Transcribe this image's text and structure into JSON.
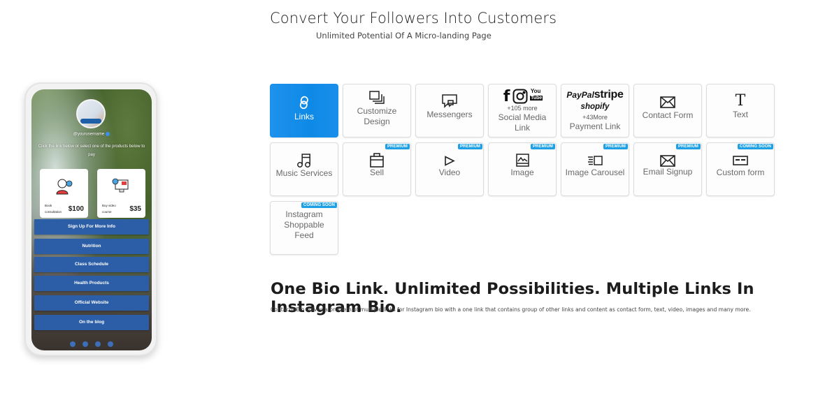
{
  "hero": {
    "title": "Convert Your Followers Into Customers",
    "subtitle": "Unlimited Potential Of A Micro-landing Page"
  },
  "phone": {
    "username": "@yourusername",
    "instructions": "Click the link below or select one of the products below to pay",
    "products": [
      {
        "name": "Book consultation",
        "price": "$100",
        "icon": "consultant-icon"
      },
      {
        "name": "Buy video course",
        "price": "$35",
        "icon": "video-course-icon"
      }
    ],
    "links": [
      "Sign Up For More Info",
      "Nutrition",
      "Class Schedule",
      "Health Products",
      "Official Website",
      "On the blog"
    ],
    "link_color": "#2c5ea8"
  },
  "features": [
    {
      "label": "Links",
      "icon": "link-icon",
      "active": true,
      "badge": null
    },
    {
      "label": "Customize Design",
      "icon": "layers-icon",
      "badge": null
    },
    {
      "label": "Messengers",
      "icon": "chat-bubbles-icon",
      "badge": null
    },
    {
      "label": "Social Media Link",
      "icon": "social-brands-icon",
      "extra": "+105 more",
      "brands": [
        "f",
        "Instagram",
        "YouTube"
      ],
      "badge": null
    },
    {
      "label": "Payment Link",
      "icon": "payment-brands-icon",
      "extra": "+43More",
      "brands": [
        "PayPal",
        "stripe",
        "shopify"
      ],
      "badge": null
    },
    {
      "label": "Contact Form",
      "icon": "envelope-icon",
      "badge": null
    },
    {
      "label": "Text",
      "icon": "text-t-icon",
      "badge": null
    },
    {
      "label": "Music Services",
      "icon": "music-note-icon",
      "badge": null
    },
    {
      "label": "Sell",
      "icon": "shopping-bag-icon",
      "badge": "PREMIUM"
    },
    {
      "label": "Video",
      "icon": "play-icon",
      "badge": "PREMIUM"
    },
    {
      "label": "Image",
      "icon": "image-icon",
      "badge": "PREMIUM"
    },
    {
      "label": "Image Carousel",
      "icon": "carousel-icon",
      "badge": "PREMIUM"
    },
    {
      "label": "Email Signup",
      "icon": "envelope-icon",
      "badge": "PREMIUM"
    },
    {
      "label": "Custom form",
      "icon": "form-icon",
      "badge": "COMING SOON"
    },
    {
      "label": "Instagram Shoppable Feed",
      "icon": null,
      "badge": "COMING SOON"
    }
  ],
  "tagline": {
    "title": "One Bio Link. Unlimited Possibilities. Multiple Links In Instagram Bio.",
    "description": "ContactInBio solves a problem of multiple links for Instagram bio with a one link that contains group of other links and content as contact form, text, video, images and many more."
  },
  "colors": {
    "accent": "#0d8ae6",
    "badge": "#1ea0e6",
    "phone_button": "#2c5ea8"
  }
}
